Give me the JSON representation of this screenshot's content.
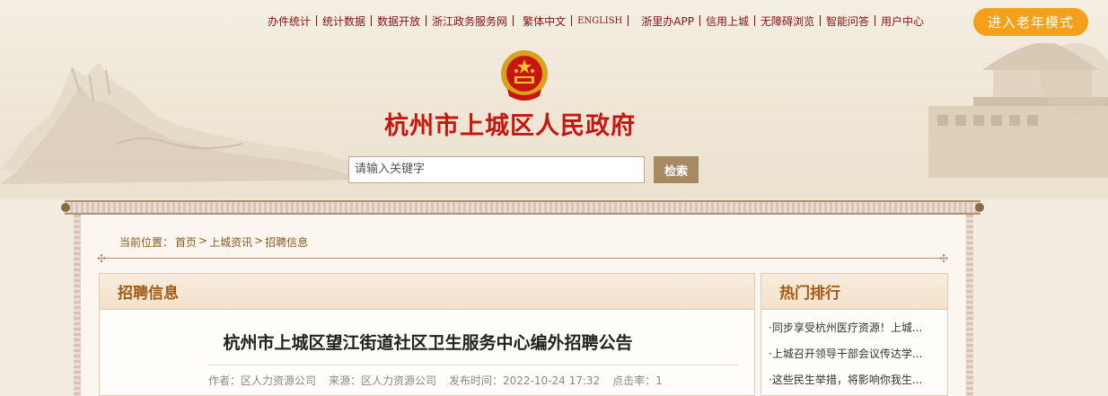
{
  "topnav": {
    "items": [
      "办件统计",
      "统计数据",
      "数据开放",
      "浙江政务服务网",
      "繁体中文",
      "ENGLISH",
      "浙里办APP",
      "信用上城",
      "无障碍浏览",
      "智能问答",
      "用户中心"
    ]
  },
  "elder_mode_label": "进入老年模式",
  "site_title": "杭州市上城区人民政府",
  "search": {
    "placeholder": "请输入关键字",
    "button_label": "检索"
  },
  "breadcrumb": {
    "prefix": "当前位置：",
    "items": [
      "首页",
      "上城资讯",
      "招聘信息"
    ],
    "separator": ">"
  },
  "main": {
    "section_title": "招聘信息",
    "article": {
      "title": "杭州市上城区望江街道社区卫生服务中心编外招聘公告",
      "author": "作者：区人力资源公司",
      "source": "来源：区人力资源公司",
      "publish_time": "发布时间：2022-10-24 17:32",
      "clicks": "点击率：1"
    }
  },
  "sidebar": {
    "section_title": "热门排行",
    "items": [
      "·同步享受杭州医疗资源！上城...",
      "·上城召开领导干部会议传达学...",
      "·这些民生举措，将影响你我生..."
    ]
  },
  "colors": {
    "accent_red": "#c8160e",
    "nav_red": "#8a1010",
    "elder_orange": "#f5a01a",
    "panel_title": "#a45a14"
  }
}
